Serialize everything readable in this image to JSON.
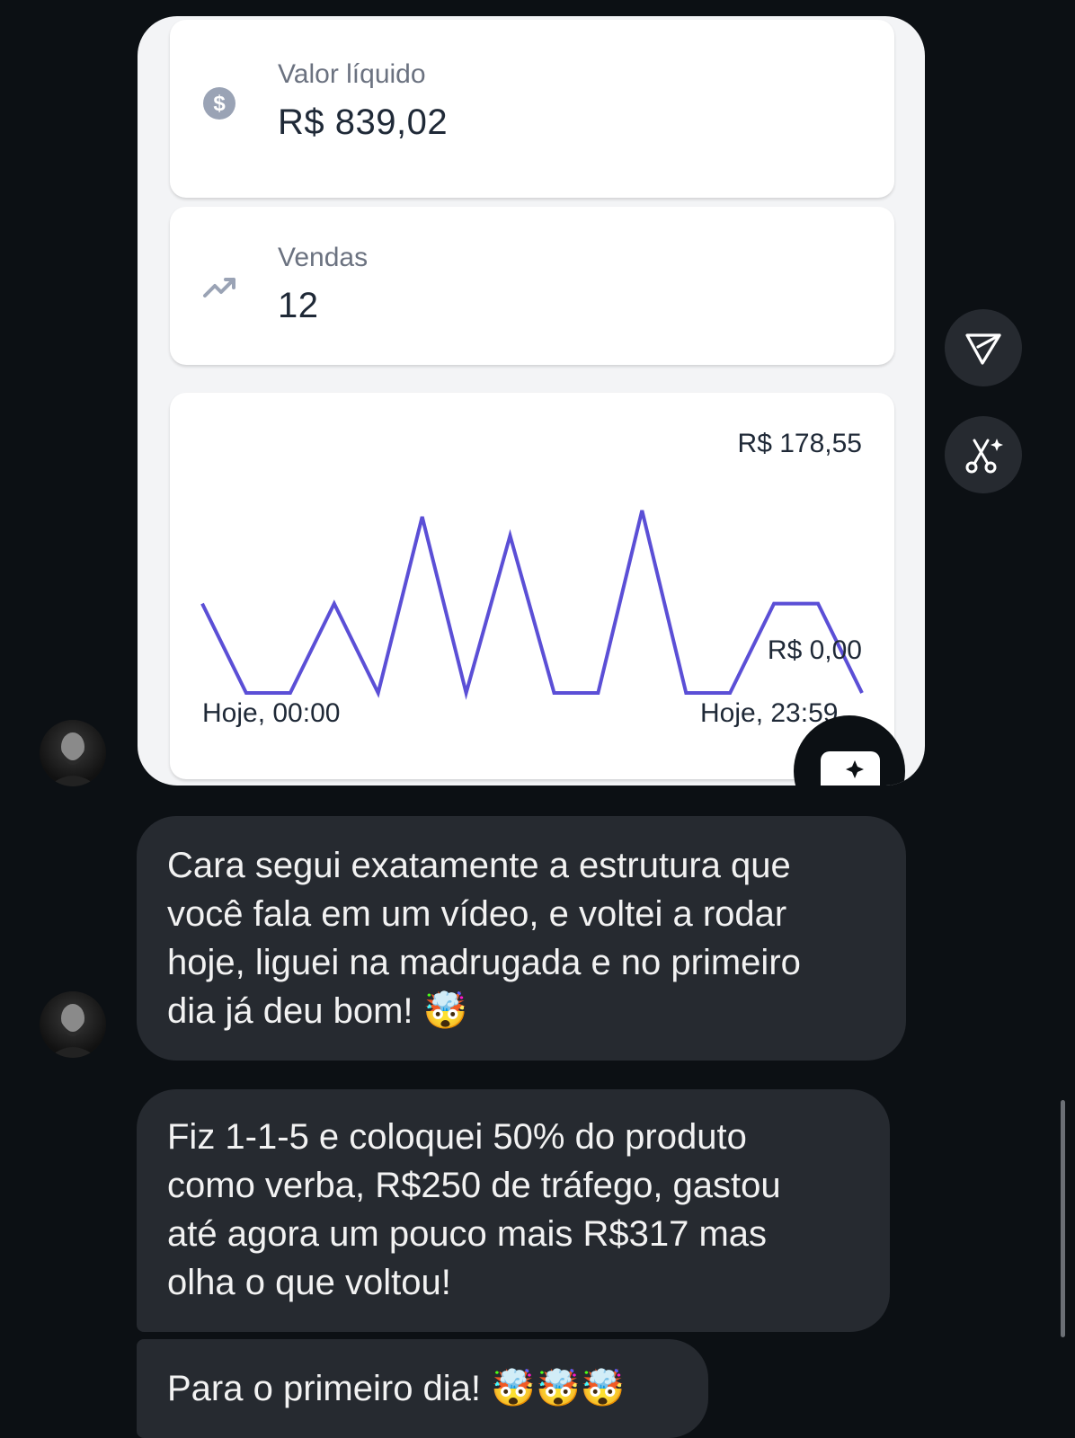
{
  "shared_post": {
    "net_value": {
      "label": "Valor líquido",
      "value": "R$ 839,02",
      "icon": "dollar-icon"
    },
    "sales": {
      "label": "Vendas",
      "value": "12",
      "icon": "trending-up-icon"
    },
    "chart": {
      "max_label": "R$ 178,55",
      "min_label": "R$ 0,00",
      "start_label": "Hoje, 00:00",
      "end_label": "Hoje, 23:59"
    }
  },
  "chart_data": {
    "type": "line",
    "x_start": "Hoje, 00:00",
    "x_end": "Hoje, 23:59",
    "ylim": [
      0,
      178.55
    ],
    "values": [
      71,
      0,
      0,
      71,
      0,
      140,
      0,
      125,
      0,
      0,
      145,
      0,
      0,
      71,
      71,
      0
    ],
    "line_color": "#5b4fd6",
    "grid": false
  },
  "side_actions": {
    "share_icon": "send-icon",
    "ai_icon": "ai-remix-icon"
  },
  "messages": [
    {
      "text_lines": [
        "Cara segui exatamente a estrutura que",
        "você fala em um vídeo, e voltei a rodar",
        "hoje, liguei na madrugada e no primeiro",
        "dia já deu bom! 🤯"
      ]
    },
    {
      "text_lines": [
        "Fiz 1-1-5 e coloquei 50% do produto",
        "como verba, R$250 de tráfego, gastou",
        "até agora um pouco mais R$317 mas",
        "olha o que voltou!"
      ]
    },
    {
      "text_lines": [
        "Para o primeiro dia! 🤯🤯🤯"
      ]
    }
  ],
  "colors": {
    "background": "#0c1014",
    "bubble": "#262a30",
    "accent_line": "#5b4fd6"
  }
}
